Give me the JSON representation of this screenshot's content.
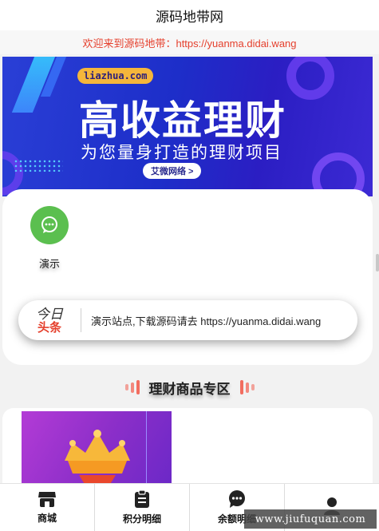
{
  "header": {
    "title": "源码地带网"
  },
  "notice": {
    "text": "欢迎来到源码地带：https://yuanma.didai.wang"
  },
  "banner": {
    "badge": "liazhua.com",
    "headline": "高收益理财",
    "subline": "为您量身打造的理财项目",
    "button": "艾微网络 >"
  },
  "grid": {
    "items": [
      {
        "label": "演示",
        "icon": "chat-bubble-icon"
      }
    ]
  },
  "toutiao": {
    "logo_top": "今日",
    "logo_bottom": "头条",
    "message": "演示站点,下载源码请去 https://yuanma.didai.wang"
  },
  "section": {
    "title": "理财商品专区"
  },
  "tabbar": {
    "items": [
      {
        "label": "商城",
        "icon": "store-icon"
      },
      {
        "label": "积分明细",
        "icon": "clipboard-icon"
      },
      {
        "label": "余额明细",
        "icon": "chat-icon"
      },
      {
        "label": "",
        "icon": "user-icon"
      }
    ]
  },
  "watermark": {
    "text": "www.jiufuquan.com"
  },
  "colors": {
    "accent_red": "#e5402d",
    "green": "#5bbf4f",
    "banner_blue": "#1d2ec9"
  }
}
